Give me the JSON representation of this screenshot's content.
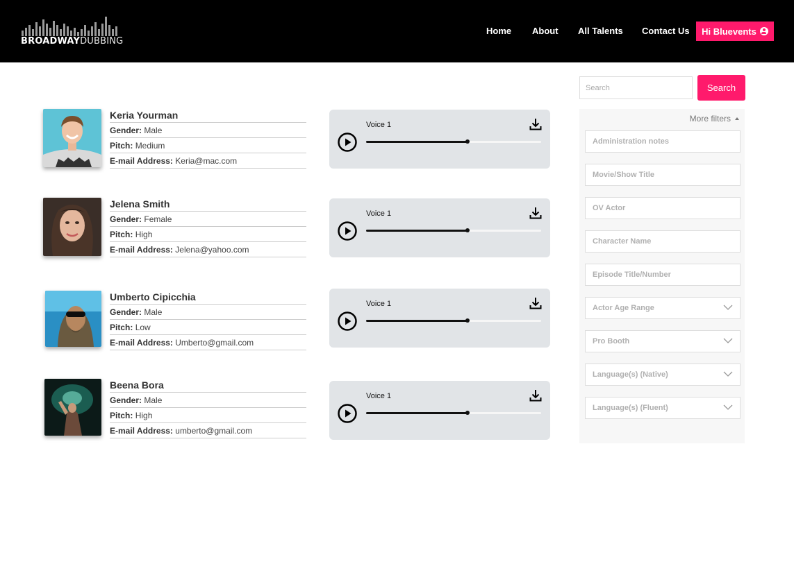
{
  "brand": {
    "logo_bold": "BROADWAY",
    "logo_light": "DUBBING"
  },
  "nav": {
    "home": "Home",
    "about": "About",
    "all_talents": "All Talents",
    "contact": "Contact Us",
    "user_greeting": "Hi Bluevents"
  },
  "talents": [
    {
      "name": "Keria  Yourman",
      "gender_label": "Gender:",
      "gender": "Male",
      "pitch_label": "Pitch:",
      "pitch": "Medium",
      "email_label": "E-mail Address:",
      "email": "Keria@mac.com",
      "voice_label": "Voice 1",
      "progress": 0.58
    },
    {
      "name": "Jelena Smith",
      "gender_label": "Gender:",
      "gender": "Female",
      "pitch_label": "Pitch:",
      "pitch": "High",
      "email_label": "E-mail Address:",
      "email": "Jelena@yahoo.com",
      "voice_label": "Voice 1",
      "progress": 0.58
    },
    {
      "name": "Umberto Cipicchia",
      "gender_label": "Gender:",
      "gender": "Male",
      "pitch_label": "Pitch:",
      "pitch": "Low",
      "email_label": "E-mail Address:",
      "email": "Umberto@gmail.com",
      "voice_label": "Voice 1",
      "progress": 0.58
    },
    {
      "name": "Beena Bora",
      "gender_label": "Gender:",
      "gender": "Male",
      "pitch_label": "Pitch:",
      "pitch": "High",
      "email_label": "E-mail Address:",
      "email": "umberto@gmail.com",
      "voice_label": "Voice 1",
      "progress": 0.58
    }
  ],
  "search": {
    "placeholder": "Search",
    "button": "Search"
  },
  "filters": {
    "more_filters": "More filters",
    "fields": [
      "Administration notes",
      "Movie/Show Title",
      "OV Actor",
      "Character Name",
      "Episode Title/Number"
    ],
    "dropdowns": [
      "Actor Age Range",
      "Pro Booth",
      "Language(s) (Native)",
      "Language(s) (Fluent)"
    ]
  },
  "colors": {
    "accent": "#ff1a6c",
    "header_bg": "#000000",
    "player_bg": "#e1e4e7"
  }
}
